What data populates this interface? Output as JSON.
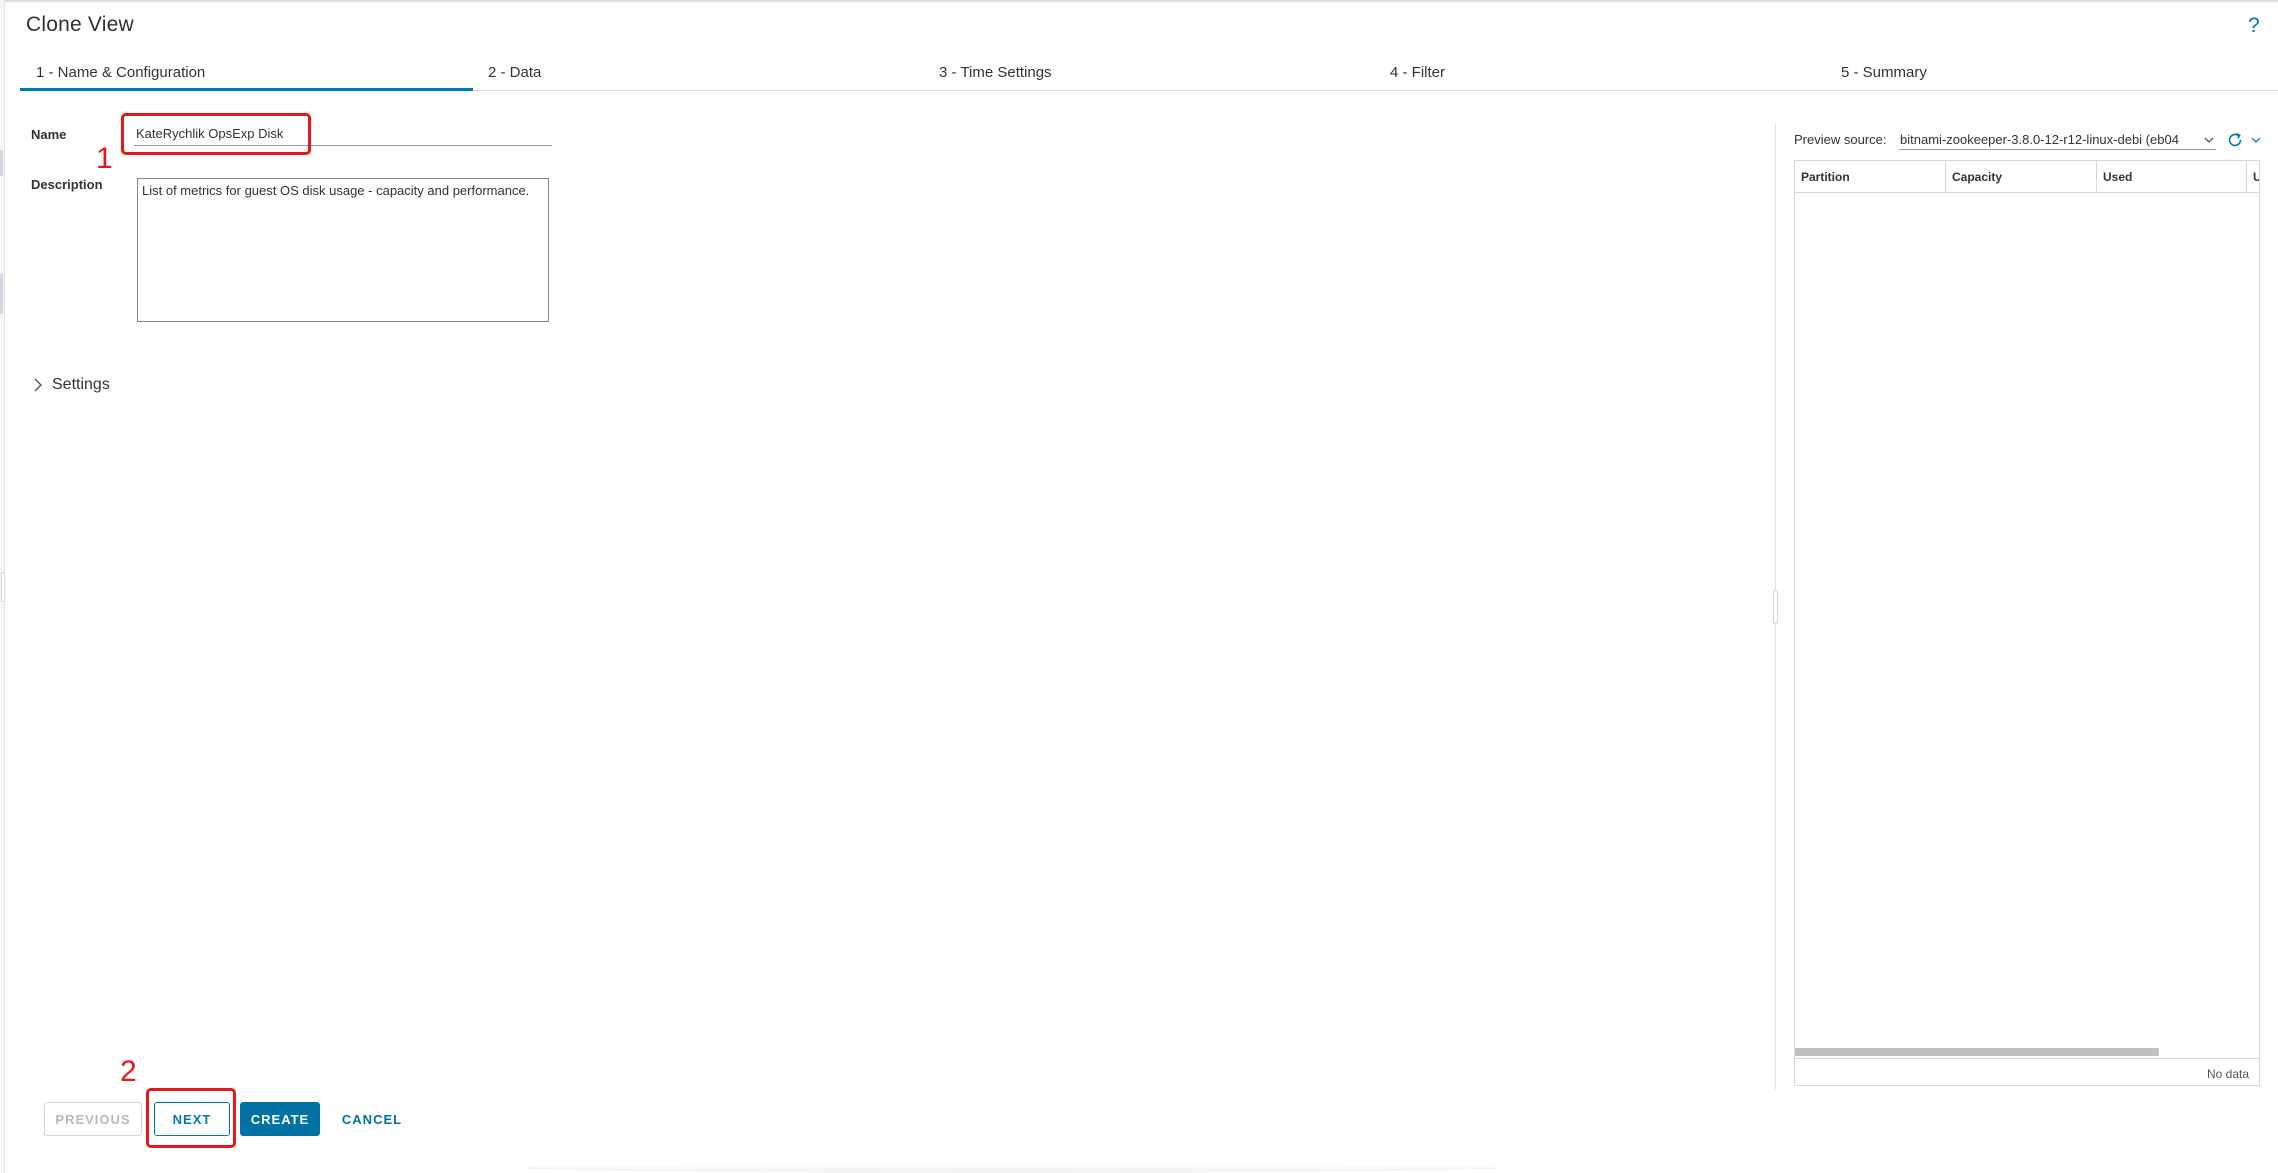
{
  "window": {
    "title": "Clone View",
    "help_label": "?"
  },
  "tabs": [
    {
      "label": "1 - Name & Configuration",
      "active": true
    },
    {
      "label": "2 - Data",
      "active": false
    },
    {
      "label": "3 - Time Settings",
      "active": false
    },
    {
      "label": "4 - Filter",
      "active": false
    },
    {
      "label": "5 - Summary",
      "active": false
    }
  ],
  "form": {
    "name_label": "Name",
    "name_value": "KateRychlik OpsExp Disk",
    "description_label": "Description",
    "description_value": "List of metrics for guest OS disk usage - capacity and performance.",
    "settings_label": "Settings"
  },
  "preview": {
    "source_label": "Preview source:",
    "source_value": "bitnami-zookeeper-3.8.0-12-r12-linux-debi (eb04",
    "columns": [
      "Partition",
      "Capacity",
      "Used",
      "Us"
    ],
    "empty_text": "No data"
  },
  "buttons": {
    "previous": "PREVIOUS",
    "next": "NEXT",
    "create": "CREATE",
    "cancel": "CANCEL"
  },
  "annotations": [
    "1",
    "2"
  ],
  "colors": {
    "accent": "#0079b8",
    "primary_button": "#0072a3",
    "annotation": "#e8151b"
  }
}
